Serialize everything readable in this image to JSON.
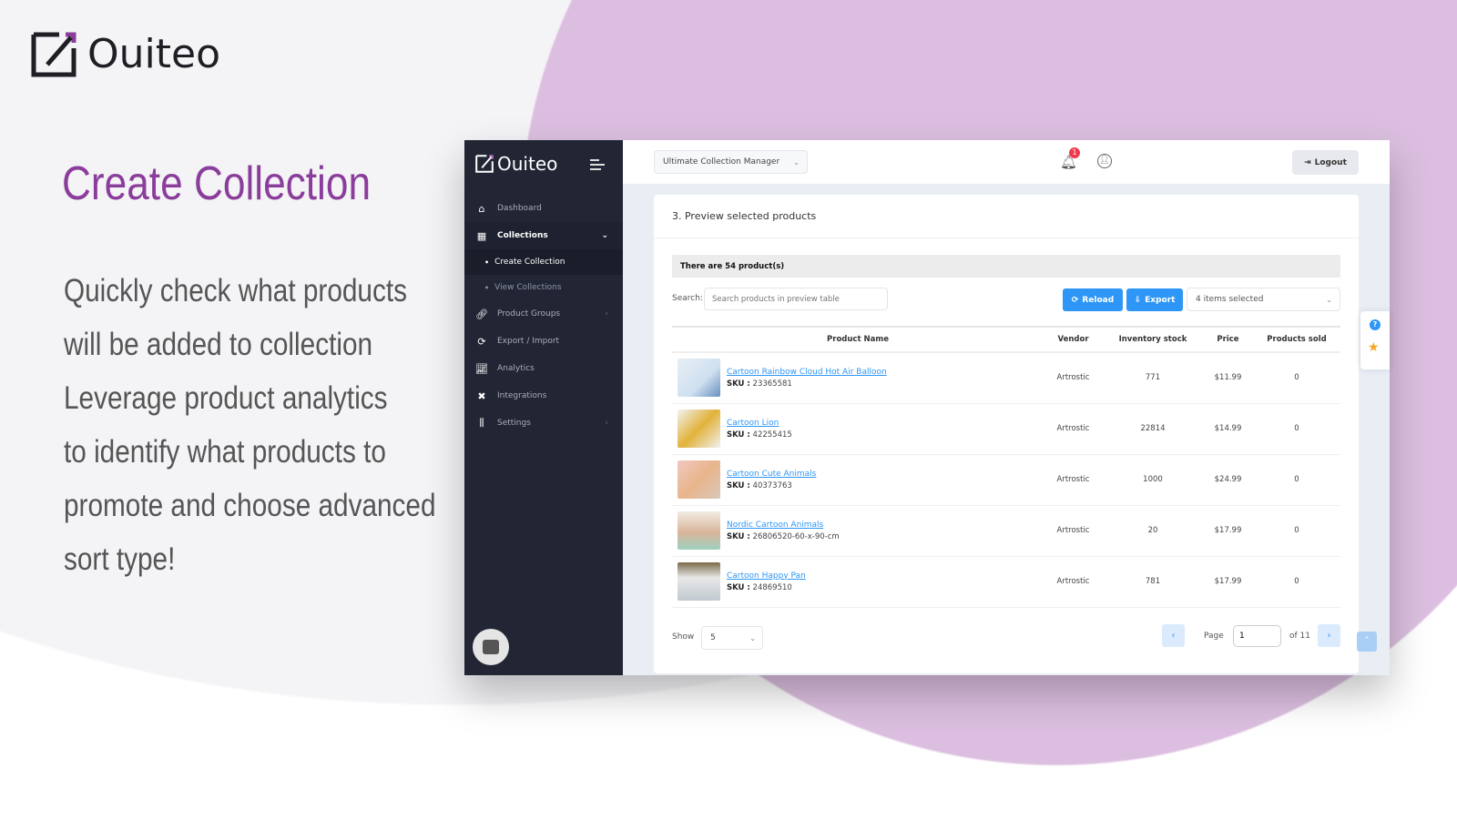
{
  "marketing": {
    "brand": "Ouiteo",
    "headline": "Create Collection",
    "description_lines": [
      "Quickly check what products",
      "will be added to collection",
      "Leverage product analytics",
      "to identify what products to",
      "promote and choose advanced",
      "sort type!"
    ],
    "colors": {
      "headline": "#8a3d9a",
      "blob": "#dcbfe0"
    }
  },
  "app": {
    "brand": "Ouiteo",
    "sidebar": {
      "items": [
        {
          "label": "Dashboard",
          "icon": "home-icon"
        },
        {
          "label": "Collections",
          "icon": "grid-icon",
          "active": true
        },
        {
          "label": "Product Groups",
          "icon": "link-icon"
        },
        {
          "label": "Export / Import",
          "icon": "sync-icon"
        },
        {
          "label": "Analytics",
          "icon": "chart-icon"
        },
        {
          "label": "Integrations",
          "icon": "plug-icon"
        },
        {
          "label": "Settings",
          "icon": "sliders-icon"
        }
      ],
      "sub_items": [
        {
          "label": "Create Collection",
          "active": true
        },
        {
          "label": "View Collections"
        }
      ]
    },
    "topbar": {
      "app_select": "Ultimate Collection Manager",
      "notification_count": "1",
      "logout": "Logout"
    },
    "card": {
      "title": "3. Preview selected products",
      "count_text": "There are 54 product(s)",
      "search_label": "Search:",
      "search_placeholder": "Search products in preview table",
      "reload": "Reload",
      "export": "Export",
      "columns_select": "4 items selected",
      "columns": [
        "Product Name",
        "Vendor",
        "Inventory stock",
        "Price",
        "Products sold"
      ],
      "sku_label": "SKU :",
      "rows": [
        {
          "name": "Cartoon Rainbow Cloud Hot Air Balloon",
          "sku": "23365581",
          "vendor": "Artrostic",
          "stock": "771",
          "price": "$11.99",
          "sold": "0"
        },
        {
          "name": "Cartoon Lion",
          "sku": "42255415",
          "vendor": "Artrostic",
          "stock": "22814",
          "price": "$14.99",
          "sold": "0"
        },
        {
          "name": "Cartoon Cute Animals",
          "sku": "40373763",
          "vendor": "Artrostic",
          "stock": "1000",
          "price": "$24.99",
          "sold": "0"
        },
        {
          "name": "Nordic Cartoon Animals",
          "sku": "26806520-60-x-90-cm",
          "vendor": "Artrostic",
          "stock": "20",
          "price": "$17.99",
          "sold": "0"
        },
        {
          "name": "Cartoon Happy Pan",
          "sku": "24869510",
          "vendor": "Artrostic",
          "stock": "781",
          "price": "$17.99",
          "sold": "0"
        }
      ],
      "show_label": "Show",
      "show_value": "5",
      "page_label": "Page",
      "page_value": "1",
      "page_of": "of 11"
    },
    "accent": "#2d96f6"
  }
}
